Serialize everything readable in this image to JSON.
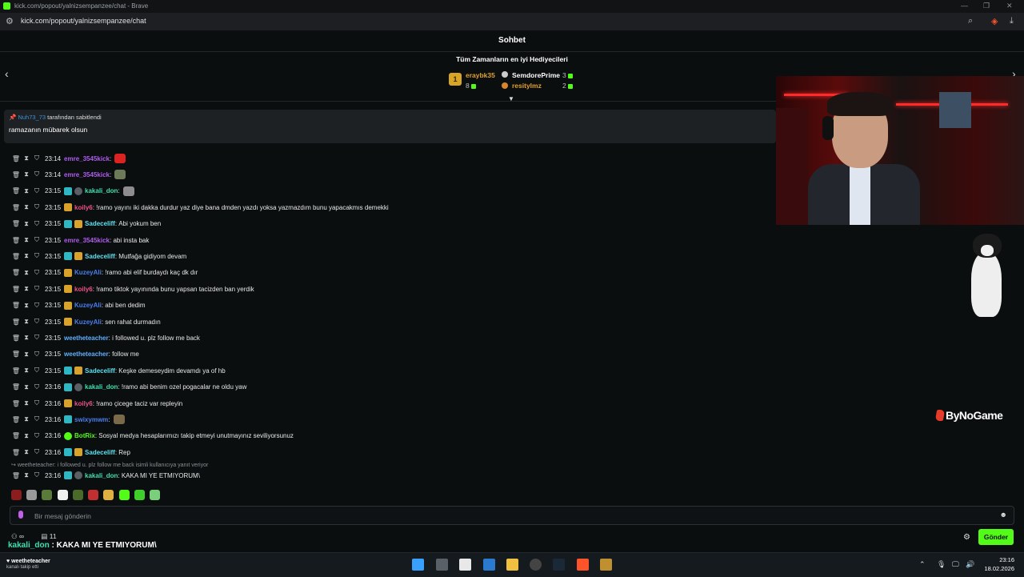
{
  "browser": {
    "window_title": "kick.com/popout/yalnizsempanzee/chat - Brave",
    "url": "kick.com/popout/yalnizsempanzee/chat"
  },
  "chat": {
    "title": "Sohbet",
    "gifters_title": "Tüm Zamanların en iyi Hediyecileri",
    "top_gifter": {
      "rank": "1",
      "name": "eraybk35",
      "count": "8"
    },
    "gifters": [
      {
        "name": "SemdorePrime",
        "count": "3",
        "color": "#ffffff"
      },
      {
        "name": "resitylmz",
        "count": "2",
        "color": "#e0a030"
      }
    ],
    "pinned": {
      "pinned_by_user": "Nuh73_73",
      "pinned_by_text": "tarafından sabitlendi",
      "message": "ramazanın mübarek olsun"
    },
    "messages": [
      {
        "time": "23:14",
        "user": "emre_3545kick",
        "color": "#b05cf0",
        "text": "",
        "badges": [],
        "emote": "#d22"
      },
      {
        "time": "23:14",
        "user": "emre_3545kick",
        "color": "#b05cf0",
        "text": "",
        "badges": [],
        "emote": "#6c7a5a"
      },
      {
        "time": "23:15",
        "user": "kakali_don",
        "color": "#3fe0b0",
        "text": "",
        "badges": [
          "teal",
          "star"
        ],
        "emote": "#8d8d8d"
      },
      {
        "time": "23:15",
        "user": "koily6",
        "color": "#f0508a",
        "text": "!ramo yayını iki dakka durdur yaz diye bana dmden yazdı yoksa yazmazdım bunu yapacakmıs demekki",
        "badges": [
          "crown"
        ]
      },
      {
        "time": "23:15",
        "user": "Sadeceliff",
        "color": "#5fe0f0",
        "text": "Abi yokum ben",
        "badges": [
          "teal",
          "crown"
        ]
      },
      {
        "time": "23:15",
        "user": "emre_3545kick",
        "color": "#b05cf0",
        "text": "abi insta bak",
        "badges": []
      },
      {
        "time": "23:15",
        "user": "Sadeceliff",
        "color": "#5fe0f0",
        "text": "Mutfağa gidiyom devam",
        "badges": [
          "teal",
          "crown"
        ]
      },
      {
        "time": "23:15",
        "user": "KuzeyAli",
        "color": "#4a7ff0",
        "text": "!ramo abi elif burdaydı kaç dk dır",
        "badges": [
          "crown"
        ]
      },
      {
        "time": "23:15",
        "user": "koily6",
        "color": "#f0508a",
        "text": "!ramo tiktok yayınında bunu yapsan tacizden ban yerdik",
        "badges": [
          "crown"
        ]
      },
      {
        "time": "23:15",
        "user": "KuzeyAli",
        "color": "#4a7ff0",
        "text": "abi ben dedim",
        "badges": [
          "crown"
        ]
      },
      {
        "time": "23:15",
        "user": "KuzeyAli",
        "color": "#4a7ff0",
        "text": "sen rahat durmadın",
        "badges": [
          "crown"
        ]
      },
      {
        "time": "23:15",
        "user": "weetheteacher",
        "color": "#5fb0ff",
        "text": "i followed u. plz follow me back",
        "badges": []
      },
      {
        "time": "23:15",
        "user": "weetheteacher",
        "color": "#5fb0ff",
        "text": "follow me",
        "badges": []
      },
      {
        "time": "23:15",
        "user": "Sadeceliff",
        "color": "#5fe0f0",
        "text": "Keşke demeseydim devamdı ya of hb",
        "badges": [
          "teal",
          "crown"
        ]
      },
      {
        "time": "23:16",
        "user": "kakali_don",
        "color": "#3fe0b0",
        "text": "!ramo abi benim ozel pogacalar ne oldu yaw",
        "badges": [
          "teal",
          "star"
        ]
      },
      {
        "time": "23:16",
        "user": "koily6",
        "color": "#f0508a",
        "text": "!ramo çicege taciz var repleyin",
        "badges": [
          "crown"
        ]
      },
      {
        "time": "23:16",
        "user": "swixymwm",
        "color": "#4a7ff0",
        "text": "",
        "badges": [
          "teal"
        ],
        "emote": "#7a6a4a"
      },
      {
        "time": "23:16",
        "user": "BotRix",
        "color": "#53fc18",
        "text": "Sosyal medya hesaplarımızı takip etmeyi unutmayınız seviliyorsunuz",
        "badges": [
          "green"
        ]
      },
      {
        "time": "23:16",
        "user": "Sadeceliff",
        "color": "#5fe0f0",
        "text": "Rep",
        "badges": [
          "teal",
          "crown"
        ]
      }
    ],
    "reply_note": "weetheteacher: i followed u. plz follow me back isimli kullanıcıya yanıt veriyor",
    "reply_message": {
      "time": "23:16",
      "user": "kakali_don",
      "color": "#3fe0b0",
      "text": "KAKA MI YE ETMIYORUM\\"
    },
    "input_placeholder": "Bir mesaj gönderin",
    "send_label": "Gönder",
    "bottom_count": "11",
    "bottom_infinity": "∞",
    "overlay_user": "kakali_don",
    "overlay_text": ": KAKA MI YE ETMIYORUM\\"
  },
  "overlay": {
    "brand": "ByNoGame"
  },
  "taskbar": {
    "follow_user": "weetheteacher",
    "follow_text": "kanalı takip etti",
    "time": "23:16",
    "date": "18.02.2026"
  },
  "colors": {
    "kick_green": "#53fc18",
    "background": "#0b0e0f",
    "crown": "#d9a22a"
  }
}
